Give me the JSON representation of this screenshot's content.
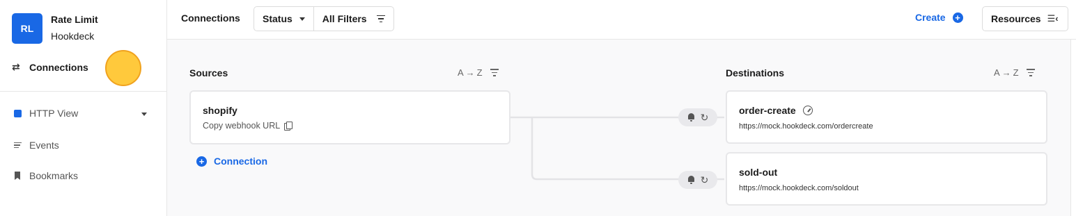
{
  "sidebar": {
    "avatar_initials": "RL",
    "org_name": "Rate Limit",
    "org_sub": "Hookdeck",
    "primary_nav": {
      "label": "Connections",
      "icon": "arrows-swap-icon"
    },
    "items": [
      {
        "label": "HTTP View",
        "icon": "blue-square-icon"
      },
      {
        "label": "Events",
        "icon": "list-lines-icon"
      },
      {
        "label": "Bookmarks",
        "icon": "bookmark-icon"
      }
    ]
  },
  "topbar": {
    "title": "Connections",
    "status_filter": "Status",
    "all_filters": "All Filters",
    "create": "Create",
    "resources": "Resources"
  },
  "sources": {
    "heading": "Sources",
    "sort_from": "A",
    "sort_to": "Z",
    "items": [
      {
        "name": "shopify",
        "action": "Copy webhook URL"
      }
    ],
    "add_connection": "Connection"
  },
  "destinations": {
    "heading": "Destinations",
    "sort_from": "A",
    "sort_to": "Z",
    "items": [
      {
        "name": "order-create",
        "url": "https://mock.hookdeck.com/ordercreate",
        "has_rate_limit": true
      },
      {
        "name": "sold-out",
        "url": "https://mock.hookdeck.com/soldout",
        "has_rate_limit": false
      }
    ]
  },
  "colors": {
    "accent": "#1968e5",
    "cursor_highlight": "#ffc93c"
  }
}
